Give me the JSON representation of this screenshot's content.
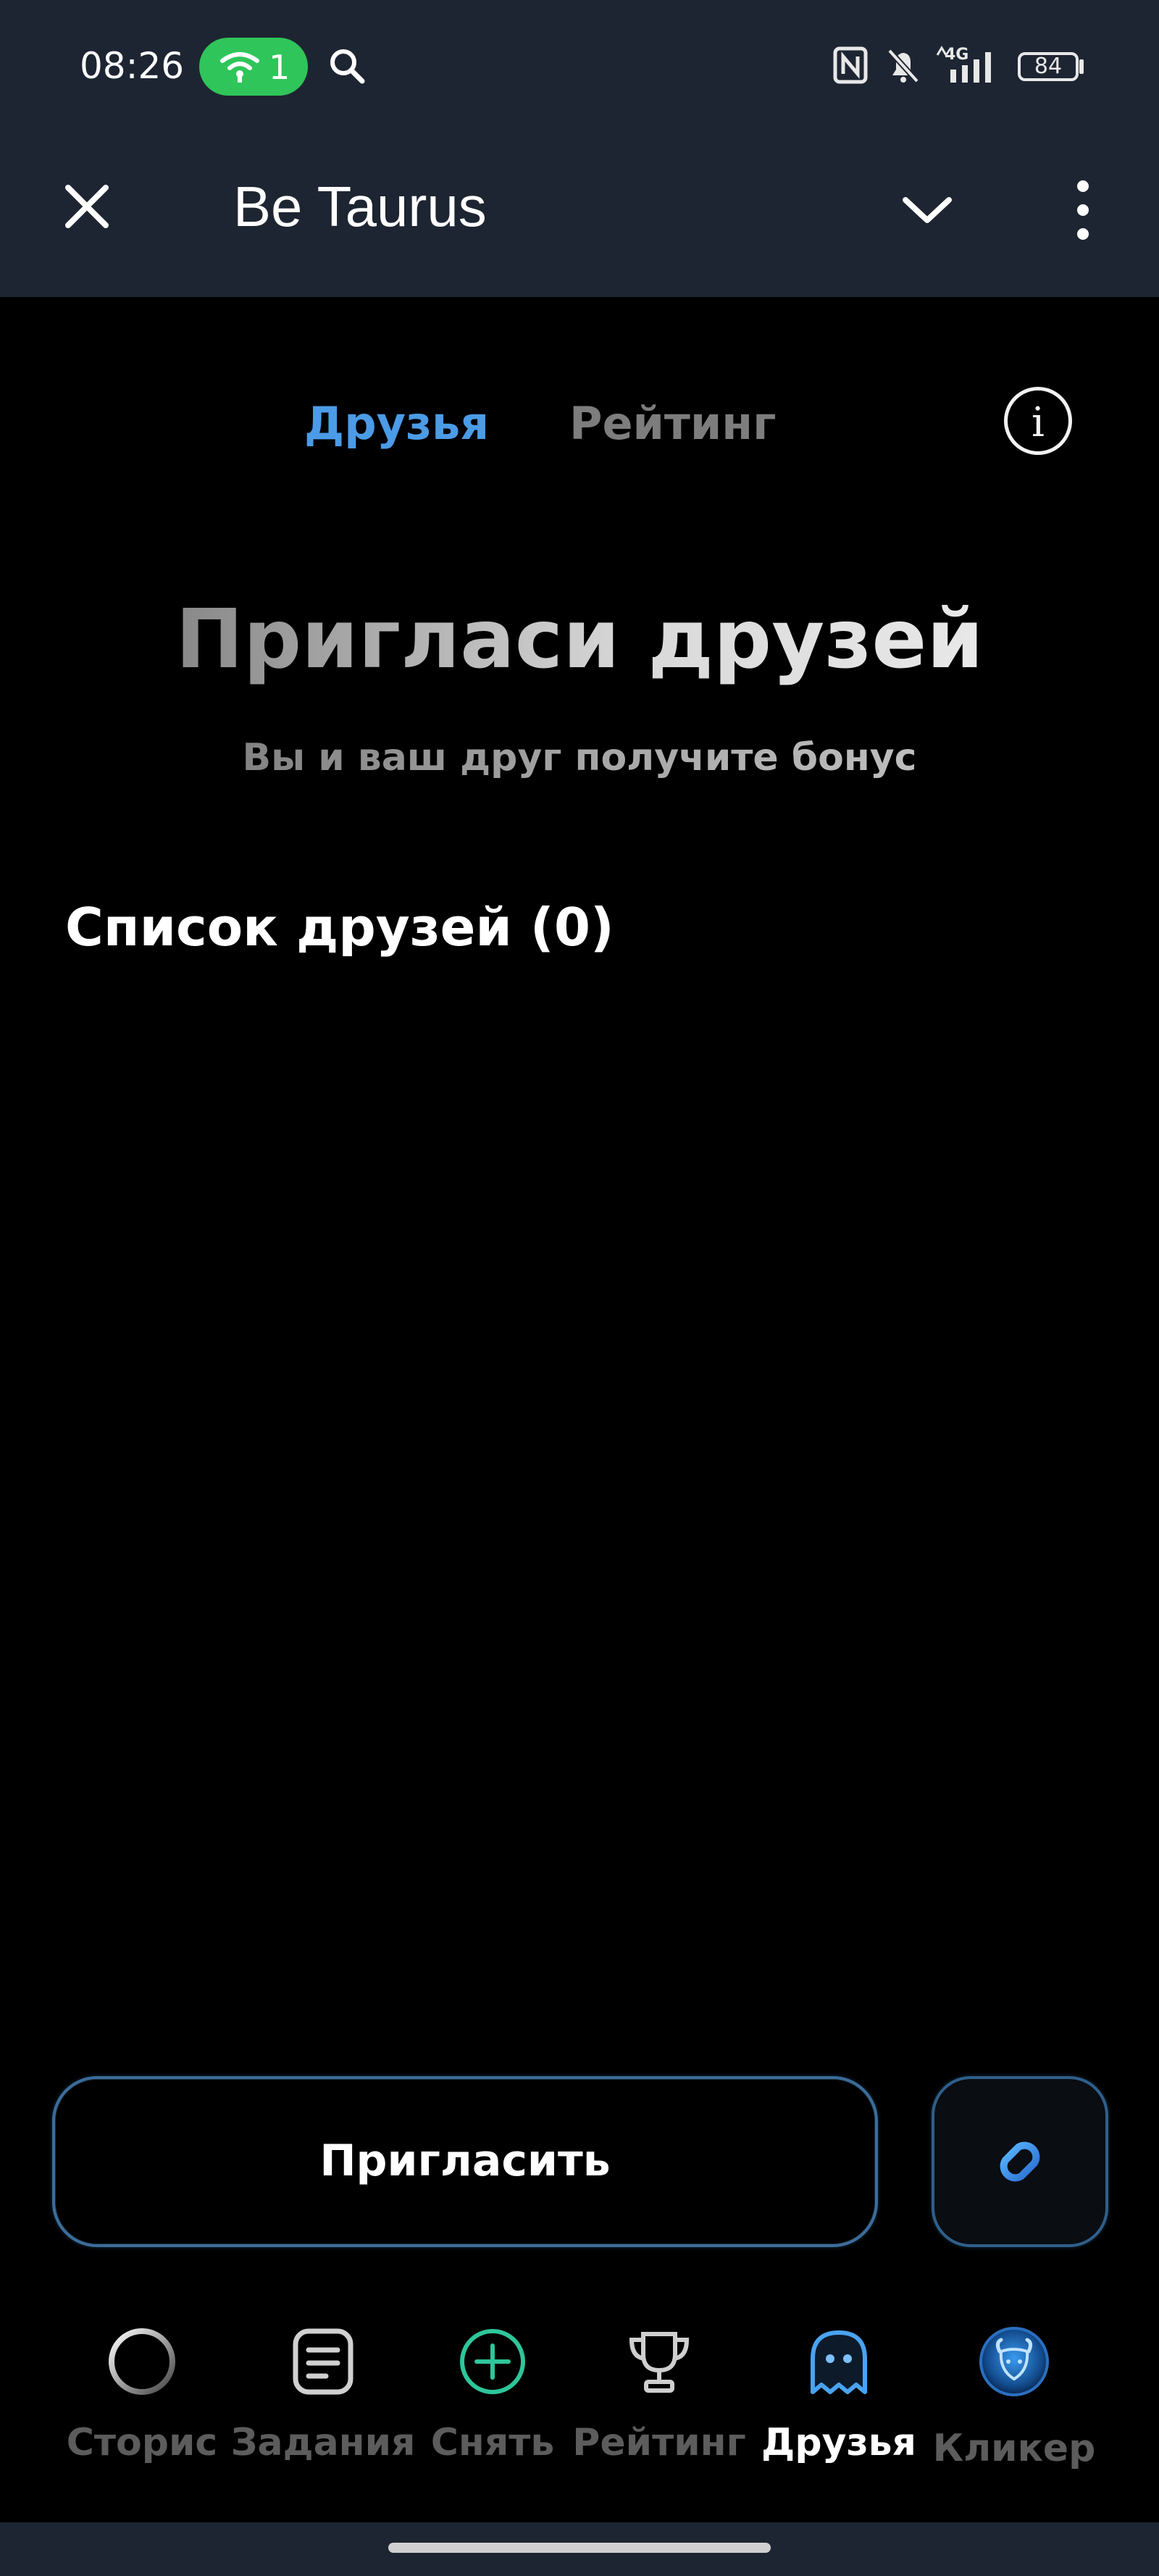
{
  "status_bar": {
    "time": "08:26",
    "hotspot_count": "1",
    "network": "4G",
    "battery": "84"
  },
  "header": {
    "title": "Be Taurus"
  },
  "tabs": {
    "friends": "Друзья",
    "rating": "Рейтинг"
  },
  "hero": {
    "title": "Пригласи друзей",
    "subtitle": "Вы и ваш друг получите бонус"
  },
  "friends_list": {
    "title": "Список друзей (0)"
  },
  "actions": {
    "invite": "Пригласить"
  },
  "nav": {
    "items": [
      {
        "label": "Сторис",
        "icon": "circle-icon"
      },
      {
        "label": "Задания",
        "icon": "tasks-icon"
      },
      {
        "label": "Снять",
        "icon": "plus-circle-icon"
      },
      {
        "label": "Рейтинг",
        "icon": "trophy-icon"
      },
      {
        "label": "Друзья",
        "icon": "ghost-icon"
      },
      {
        "label": "Кликер",
        "icon": "taurus-coin-icon"
      }
    ],
    "active_index": 4
  },
  "colors": {
    "accent": "#4b9be6",
    "header_bg": "#1e2532",
    "hotspot": "#2fc55a"
  }
}
